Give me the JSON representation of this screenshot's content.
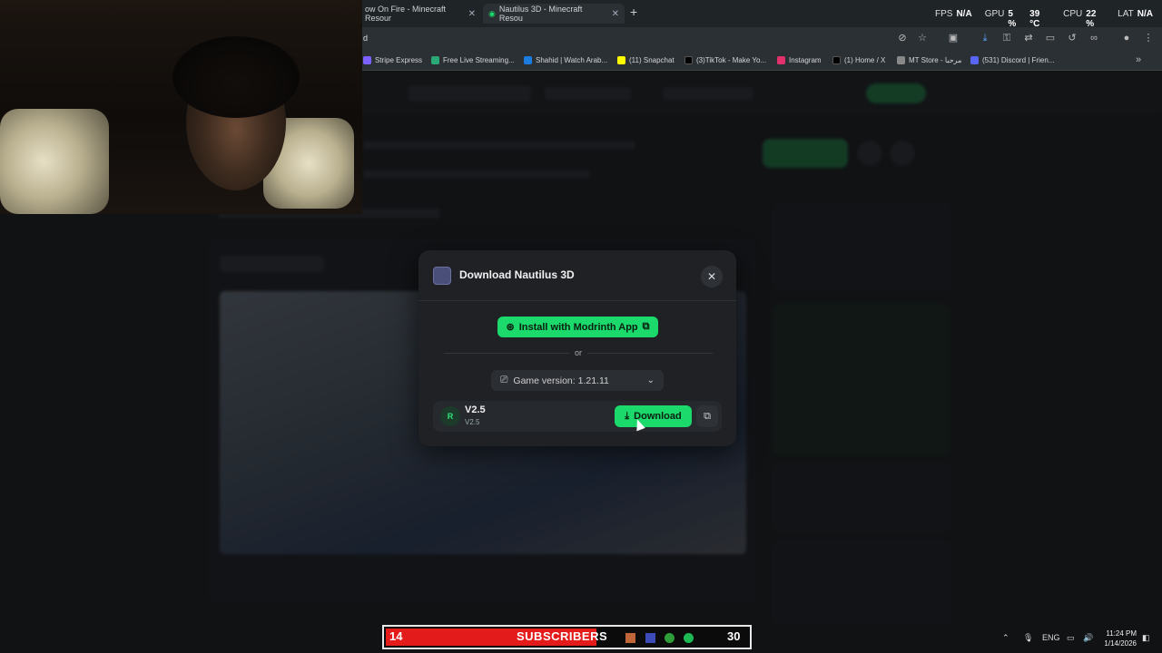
{
  "browser": {
    "tabs": [
      {
        "label": "ow On Fire - Minecraft Resour",
        "active": false
      },
      {
        "label": "Nautilus 3D - Minecraft Resou",
        "active": true
      }
    ],
    "url_fragment": "d",
    "new_tab_icon": "plus-icon"
  },
  "stats": {
    "fps_label": "FPS",
    "fps_value": "N/A",
    "gpu_label": "GPU",
    "gpu_value": "5 %",
    "gpu_temp": "39 °C",
    "cpu_label": "CPU",
    "cpu_value": "22 %",
    "lat_label": "LAT",
    "lat_value": "N/A"
  },
  "bookmarks": [
    {
      "label": "Stripe Express",
      "color": "#7b61ff"
    },
    {
      "label": "Free Live Streaming...",
      "color": "#2aa876"
    },
    {
      "label": "Shahid | Watch Arab...",
      "color": "#1c7ce0"
    },
    {
      "label": "(11) Snapchat",
      "color": "#fffc00"
    },
    {
      "label": "(3)TikTok - Make Yo...",
      "color": "#000000"
    },
    {
      "label": "Instagram",
      "color": "#e1306c"
    },
    {
      "label": "(1) Home / X",
      "color": "#000000"
    },
    {
      "label": "MT Store - مرحبا",
      "color": "#888888"
    },
    {
      "label": "(531) Discord | Frien...",
      "color": "#5865f2"
    }
  ],
  "modal": {
    "title": "Download Nautilus 3D",
    "install_label": "Install with Modrinth App",
    "or_label": "or",
    "game_version_label": "Game version: 1.21.11",
    "version_avatar": "R",
    "version_name": "V2.5",
    "version_number": "V2.5",
    "download_label": "Download"
  },
  "subscriber_bar": {
    "current": "14",
    "label": "SUBSCRIBERS",
    "goal": "30"
  },
  "taskbar": {
    "lang": "ENG",
    "time": "11:24 PM",
    "date": "1/14/2026"
  },
  "colors": {
    "accent": "#1bd96a",
    "modal_bg": "#1f2125",
    "sub_bar_red": "#e31b1b"
  }
}
